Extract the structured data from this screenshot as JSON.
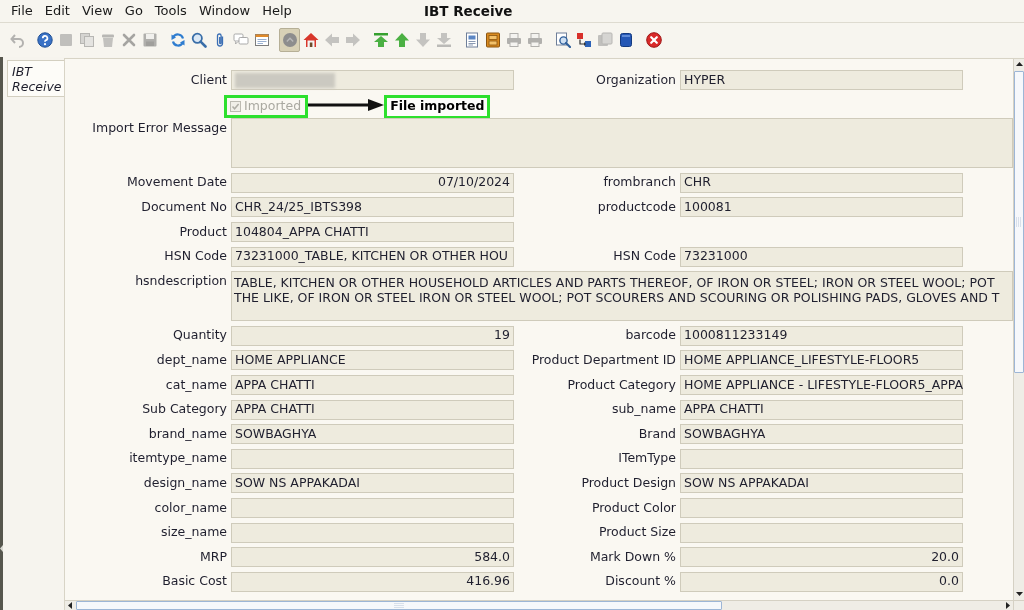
{
  "menu_bar": {
    "items": [
      "File",
      "Edit",
      "View",
      "Go",
      "Tools",
      "Window",
      "Help"
    ]
  },
  "window": {
    "title": "IBT Receive"
  },
  "toolbar": [
    [
      {
        "disabled": true,
        "pressed": false
      }
    ],
    [
      {
        "disabled": false,
        "pressed": false
      },
      {
        "disabled": true,
        "pressed": false
      },
      {
        "disabled": true,
        "pressed": false
      },
      {
        "disabled": true,
        "pressed": false
      },
      {
        "disabled": true,
        "pressed": false
      },
      {
        "disabled": true,
        "pressed": false
      }
    ],
    [
      {
        "disabled": false,
        "pressed": false
      },
      {
        "disabled": false,
        "pressed": false
      },
      {
        "disabled": false,
        "pressed": false
      },
      {
        "disabled": false,
        "pressed": false
      },
      {
        "disabled": false,
        "pressed": false
      }
    ],
    [
      {
        "disabled": false,
        "pressed": true
      },
      {
        "disabled": false,
        "pressed": false
      },
      {
        "disabled": true,
        "pressed": false
      },
      {
        "disabled": true,
        "pressed": false
      }
    ],
    [
      {
        "disabled": false,
        "pressed": false
      },
      {
        "disabled": false,
        "pressed": false
      },
      {
        "disabled": true,
        "pressed": false
      },
      {
        "disabled": true,
        "pressed": false
      }
    ],
    [
      {
        "disabled": false,
        "pressed": false
      },
      {
        "disabled": false,
        "pressed": false
      },
      {
        "disabled": true,
        "pressed": false
      },
      {
        "disabled": true,
        "pressed": false
      }
    ],
    [
      {
        "disabled": false,
        "pressed": false
      },
      {
        "disabled": false,
        "pressed": false
      },
      {
        "disabled": true,
        "pressed": false
      },
      {
        "disabled": false,
        "pressed": false
      }
    ],
    [
      {
        "disabled": false,
        "pressed": false
      }
    ]
  ],
  "side_tabs": [
    {
      "label": "IBT Receive",
      "selected": true
    }
  ],
  "form": {
    "rows": [
      {
        "left": {
          "label": "Client",
          "kind": "text",
          "redacted": true
        },
        "right": {
          "label": "Organization",
          "kind": "text",
          "value": "HYPER"
        }
      },
      {
        "left": {
          "label": "Imported",
          "kind": "checkbox",
          "checked": true,
          "disabled": true,
          "annotation": {
            "text": "File imported"
          }
        }
      },
      {
        "wide": {
          "label": "Import Error Message",
          "kind": "textarea"
        }
      },
      {
        "left": {
          "label": "Movement Date",
          "kind": "date",
          "value": "07/10/2024"
        },
        "right": {
          "label": "frombranch",
          "kind": "text",
          "value": "CHR"
        }
      },
      {
        "left": {
          "label": "Document No",
          "kind": "text",
          "value": "CHR_24/25_IBTS398"
        },
        "right": {
          "label": "productcode",
          "kind": "text",
          "value": "100081"
        }
      },
      {
        "left": {
          "label": "Product",
          "kind": "text",
          "value": "104804_APPA CHATTI"
        }
      },
      {
        "left": {
          "label": "HSN Code",
          "kind": "text",
          "value": "73231000_TABLE, KITCHEN OR OTHER HOU"
        },
        "right": {
          "label": "HSN Code",
          "kind": "text",
          "value": "73231000"
        }
      },
      {
        "wide": {
          "label": "hsndescription",
          "kind": "textarea",
          "lines": [
            "TABLE, KITCHEN OR OTHER HOUSEHOLD ARTICLES AND PARTS THEREOF, OF IRON OR STEEL; IRON OR STEEL WOOL; POT",
            "THE LIKE, OF IRON OR STEEL IRON OR STEEL WOOL; POT SCOURERS AND SCOURING OR POLISHING PADS, GLOVES AND T"
          ]
        }
      },
      {
        "left": {
          "label": "Quantity",
          "kind": "number",
          "value": "19"
        },
        "right": {
          "label": "barcode",
          "kind": "text",
          "value": "1000811233149"
        }
      },
      {
        "left": {
          "label": "dept_name",
          "kind": "text",
          "value": "HOME APPLIANCE"
        },
        "right": {
          "label": "Product Department ID",
          "kind": "text",
          "value": "HOME APPLIANCE_LIFESTYLE-FLOOR5"
        }
      },
      {
        "left": {
          "label": "cat_name",
          "kind": "text",
          "value": "APPA CHATTI"
        },
        "right": {
          "label": "Product Category",
          "kind": "text",
          "value": "HOME APPLIANCE - LIFESTYLE-FLOOR5_APPA"
        }
      },
      {
        "left": {
          "label": "Sub Category",
          "kind": "text",
          "value": "APPA CHATTI"
        },
        "right": {
          "label": "sub_name",
          "kind": "text",
          "value": "APPA CHATTI"
        }
      },
      {
        "left": {
          "label": "brand_name",
          "kind": "text",
          "value": "SOWBAGHYA"
        },
        "right": {
          "label": "Brand",
          "kind": "text",
          "value": "SOWBAGHYA"
        }
      },
      {
        "left": {
          "label": "itemtype_name",
          "kind": "text"
        },
        "right": {
          "label": "ITemType",
          "kind": "text"
        }
      },
      {
        "left": {
          "label": "design_name",
          "kind": "text",
          "value": "SOW NS APPAKADAI"
        },
        "right": {
          "label": "Product Design",
          "kind": "text",
          "value": "SOW NS APPAKADAI"
        }
      },
      {
        "left": {
          "label": "color_name",
          "kind": "text"
        },
        "right": {
          "label": "Product Color",
          "kind": "text"
        }
      },
      {
        "left": {
          "label": "size_name",
          "kind": "text"
        },
        "right": {
          "label": "Product Size",
          "kind": "text"
        }
      },
      {
        "left": {
          "label": "MRP",
          "kind": "number",
          "value": "584.0"
        },
        "right": {
          "label": "Mark Down %",
          "kind": "number",
          "value": "20.0"
        }
      },
      {
        "left": {
          "label": "Basic Cost",
          "kind": "number",
          "value": "416.96"
        },
        "right": {
          "label": "Discount %",
          "kind": "number",
          "value": "0.0"
        }
      }
    ]
  }
}
